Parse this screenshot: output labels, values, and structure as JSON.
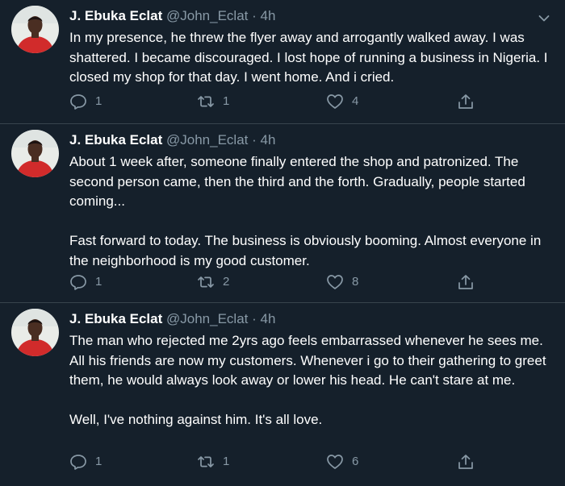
{
  "colors": {
    "background": "#15202b",
    "text_primary": "#ffffff",
    "text_secondary": "#8899a6",
    "divider": "#38444d",
    "avatar_shirt": "#d12b2b"
  },
  "tweets": [
    {
      "display_name": "J. Ebuka Eclat",
      "handle": "@John_Eclat",
      "separator": "·",
      "time": "4h",
      "paragraphs": [
        "In my presence, he threw the flyer away and arrogantly walked away. I was shattered. I became discouraged. I lost hope of running a business in Nigeria. I closed my shop for that day. I went home. And i cried."
      ],
      "reply_count": "1",
      "retweet_count": "1",
      "like_count": "4"
    },
    {
      "display_name": "J. Ebuka Eclat",
      "handle": "@John_Eclat",
      "separator": "·",
      "time": "4h",
      "paragraphs": [
        "About 1 week after, someone finally entered the shop and patronized. The second person came, then the third and the forth. Gradually, people started coming...",
        "Fast forward to today. The business is obviously booming. Almost everyone in the neighborhood is my good customer."
      ],
      "reply_count": "1",
      "retweet_count": "2",
      "like_count": "8"
    },
    {
      "display_name": "J. Ebuka Eclat",
      "handle": "@John_Eclat",
      "separator": "·",
      "time": "4h",
      "paragraphs": [
        "The man who rejected me 2yrs ago feels embarrassed whenever he sees me. All his friends are now my customers. Whenever i go to their gathering to greet them, he would always look away or lower his head. He can't stare at me.",
        "Well, I've nothing against him. It's all love."
      ],
      "reply_count": "1",
      "retweet_count": "1",
      "like_count": "6"
    }
  ],
  "icons": {
    "reply": "reply-icon",
    "retweet": "retweet-icon",
    "like": "heart-icon",
    "share": "share-icon",
    "menu": "chevron-down-icon"
  }
}
